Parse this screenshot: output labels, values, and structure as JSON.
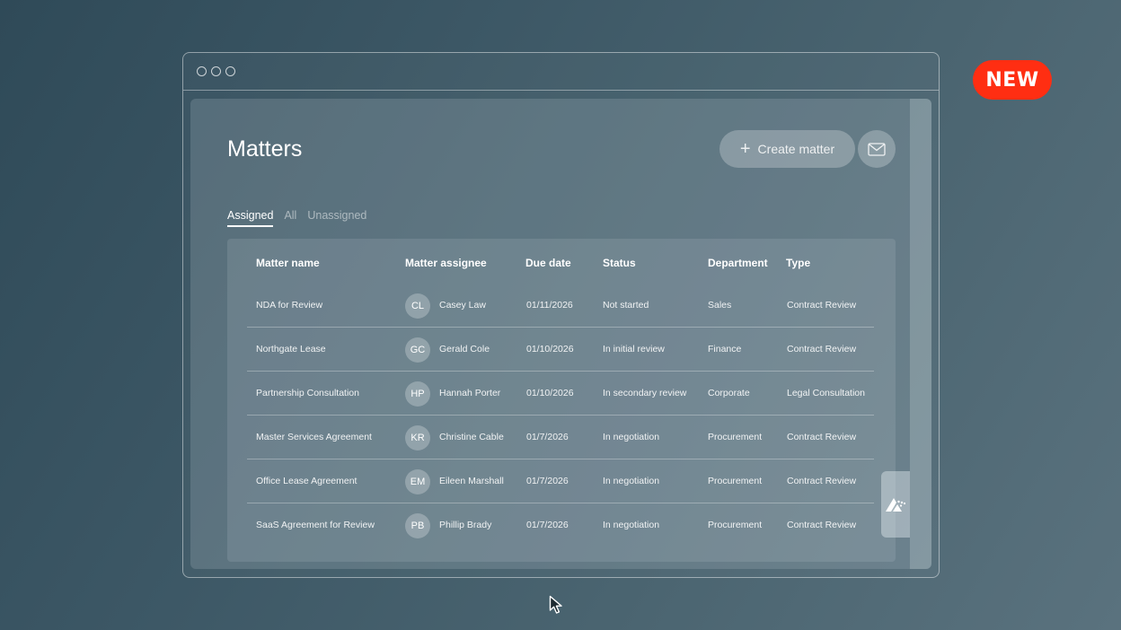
{
  "badge": {
    "label": "NEW",
    "color": "#ff2e12"
  },
  "page": {
    "title": "Matters"
  },
  "toolbar": {
    "create_label": "Create matter",
    "create_icon": "plus-icon",
    "mail_icon": "mail-icon"
  },
  "tabs": [
    {
      "label": "Assigned",
      "active": true
    },
    {
      "label": "All",
      "active": false
    },
    {
      "label": "Unassigned",
      "active": false
    }
  ],
  "table": {
    "columns": [
      "Matter name",
      "Matter assignee",
      "Due date",
      "Status",
      "Department",
      "Type"
    ],
    "rows": [
      {
        "name": "NDA for Review",
        "initials": "CL",
        "assignee": "Casey Law",
        "due": "01/11/2026",
        "status": "Not started",
        "department": "Sales",
        "type": "Contract Review"
      },
      {
        "name": "Northgate Lease",
        "initials": "GC",
        "assignee": "Gerald Cole",
        "due": "01/10/2026",
        "status": "In initial review",
        "department": "Finance",
        "type": "Contract Review"
      },
      {
        "name": "Partnership Consultation",
        "initials": "HP",
        "assignee": "Hannah Porter",
        "due": "01/10/2026",
        "status": "In secondary review",
        "department": "Corporate",
        "type": "Legal Consultation"
      },
      {
        "name": "Master Services Agreement",
        "initials": "KR",
        "assignee": "Christine Cable",
        "due": "01/7/2026",
        "status": "In negotiation",
        "department": "Procurement",
        "type": "Contract Review"
      },
      {
        "name": "Office Lease Agreement",
        "initials": "EM",
        "assignee": "Eileen Marshall",
        "due": "01/7/2026",
        "status": "In negotiation",
        "department": "Procurement",
        "type": "Contract Review"
      },
      {
        "name": "SaaS Agreement for Review",
        "initials": "PB",
        "assignee": "Phillip Brady",
        "due": "01/7/2026",
        "status": "In negotiation",
        "department": "Procurement",
        "type": "Contract Review"
      }
    ]
  },
  "side_widget": {
    "icon": "assistant-logo-icon"
  }
}
